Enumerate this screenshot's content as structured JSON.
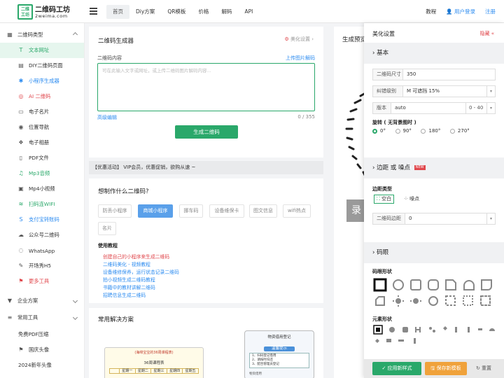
{
  "logo": {
    "box_text": "二维\n工坊",
    "title": "二维码工坊",
    "subtitle": "2weima.com"
  },
  "nav": [
    "首页",
    "Diy方案",
    "QR模板",
    "价格",
    "解码",
    "API"
  ],
  "top_right": {
    "tutorial": "教程",
    "login": "用户登录",
    "register": "注册"
  },
  "sidebar": {
    "items": [
      {
        "label": "二维码类型",
        "icon": "grid-icon"
      },
      {
        "label": "文本网址",
        "icon": "text-icon",
        "active": true
      },
      {
        "label": "DIY二维码页面",
        "icon": "diy-icon"
      },
      {
        "label": "小程序生成器",
        "icon": "miniapp-icon"
      },
      {
        "label": "AI 二维码",
        "icon": "ai-icon"
      },
      {
        "label": "电子名片",
        "icon": "card-icon"
      },
      {
        "label": "位置导航",
        "icon": "location-icon"
      },
      {
        "label": "电子相册",
        "icon": "album-icon"
      },
      {
        "label": "PDF文件",
        "icon": "pdf-icon"
      },
      {
        "label": "Mp3音频",
        "icon": "music-icon"
      },
      {
        "label": "Mp4小视频",
        "icon": "video-icon"
      },
      {
        "label": "扫码连WIFI",
        "icon": "wifi-icon"
      },
      {
        "label": "支付宝转账码",
        "icon": "alipay-icon"
      },
      {
        "label": "公众号二维码",
        "icon": "wechat-icon"
      },
      {
        "label": "WhatsApp",
        "icon": "whatsapp-icon"
      },
      {
        "label": "开场秀H5",
        "icon": "h5-icon"
      },
      {
        "label": "更多工具",
        "icon": "more-icon"
      },
      {
        "label": "企业方案",
        "icon": "enterprise-icon"
      },
      {
        "label": "常用工具",
        "icon": "tools-icon"
      },
      {
        "label": "免费PDF压缩",
        "icon": ""
      },
      {
        "label": "国庆头像",
        "icon": "flag-icon"
      },
      {
        "label": "2024新年头像",
        "icon": ""
      }
    ]
  },
  "generator": {
    "title": "二维码生成器",
    "beautify_link": "美化设置 ›",
    "content_label": "二维码内容",
    "upload_link": "上传图片解码",
    "placeholder": "可在此输入文字或网址，或上传二维码图片解码内容...",
    "advanced": "高级编辑",
    "counter": "0 / 355",
    "button": "生成二维码"
  },
  "promo": "【优惠活动】 VIP会员，优惠促销，欲购从速 ~",
  "what": {
    "title": "想制作什么二维码?",
    "tags": [
      "防丢小程序",
      "商城小程序",
      "挪车码",
      "设备维保卡",
      "图文信息",
      "wifi热点",
      "名片"
    ],
    "tutorial_title": "使用教程",
    "tutorials": [
      "创建自己的小程序来生成二维码",
      "二维码美化 - 视频教程",
      "设备维修保养，运行状态记录二维码",
      "拍小视频生成二维码教程",
      "书籍中的教材讲解二维码",
      "招聘信息生成二维码"
    ]
  },
  "solutions": {
    "title": "常用解决方案",
    "thumb1_title": "(海绵宝宝的36周课程表)",
    "thumb1_sub": "36周课程表",
    "thumb1_days": [
      "星期一",
      "星期二",
      "星期三",
      "星期四",
      "星期五"
    ],
    "thumb2_title": "物资借用登记",
    "thumb2_badge": "温馨提示",
    "thumb2_items": [
      "1、扫码登记借用",
      "2、请按时归还",
      "3、配合管理员登记"
    ],
    "thumb2_footer": "物资借用"
  },
  "preview": {
    "title": "生成预览",
    "overlay": "录"
  },
  "panel": {
    "title": "美化设置",
    "collapse": "隐藏 «",
    "basic": "› 基本",
    "size_label": "二维码尺寸",
    "size_value": "350",
    "ec_label": "纠错级别",
    "ec_value": "M 可遮挡 15%",
    "version_label": "版本",
    "version_value": "auto",
    "version_range": "0 - 40",
    "rotate_label": "旋转 ( 无背景图时 )",
    "rotations": [
      "0°",
      "90°",
      "180°",
      "270°"
    ],
    "margin_section": "› 边距 或 噪点",
    "new_badge": "NEW",
    "margin_type_label": "边距类型",
    "margin_types": [
      "空白",
      "噪点"
    ],
    "margin_label": "二维码边距",
    "margin_value": "0",
    "eye_section": "› 码眼",
    "eye_shape_label": "码眼形状",
    "element_shape_label": "元素形状",
    "apply_button": "应用新样式",
    "save_button": "保存新模板",
    "reset_button": "重置"
  },
  "colors": {
    "brand": "#2aa86a",
    "link": "#2d8cf0",
    "tag_active": "#5aa0ea",
    "save": "#f0a23b",
    "reset": "#8c8c8c"
  }
}
